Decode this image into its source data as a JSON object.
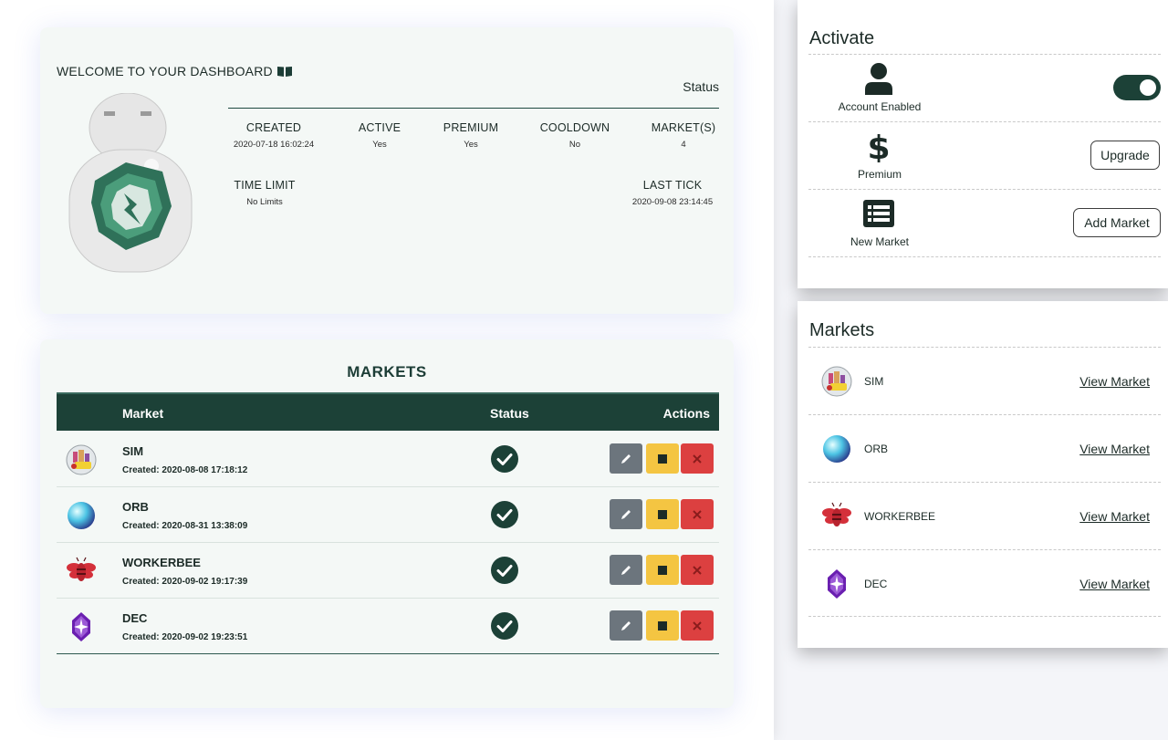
{
  "dashboard": {
    "welcome": "WELCOME TO YOUR DASHBOARD",
    "status_title": "Status",
    "stats": [
      {
        "label": "CREATED",
        "value": "2020-07-18 16:02:24"
      },
      {
        "label": "ACTIVE",
        "value": "Yes"
      },
      {
        "label": "PREMIUM",
        "value": "Yes"
      },
      {
        "label": "COOLDOWN",
        "value": "No"
      },
      {
        "label": "MARKET(S)",
        "value": "4"
      }
    ],
    "time_limit": {
      "label": "TIME LIMIT",
      "value": "No Limits"
    },
    "last_tick": {
      "label": "LAST TICK",
      "value": "2020-09-08 23:14:45"
    }
  },
  "markets_table": {
    "title": "MARKETS",
    "headers": {
      "market": "Market",
      "status": "Status",
      "actions": "Actions"
    },
    "rows": [
      {
        "name": "SIM",
        "created": "Created: 2020-08-08 17:18:12",
        "icon": "sim-city-icon"
      },
      {
        "name": "ORB",
        "created": "Created: 2020-08-31 13:38:09",
        "icon": "orb-icon"
      },
      {
        "name": "WORKERBEE",
        "created": "Created: 2020-09-02 19:17:39",
        "icon": "bee-icon"
      },
      {
        "name": "DEC",
        "created": "Created: 2020-09-02 19:23:51",
        "icon": "crystal-icon"
      }
    ]
  },
  "activate": {
    "title": "Activate",
    "items": [
      {
        "label": "Account Enabled",
        "icon": "user-icon",
        "control": "toggle",
        "enabled": true
      },
      {
        "label": "Premium",
        "icon": "dollar-icon",
        "control": "button",
        "button_label": "Upgrade"
      },
      {
        "label": "New Market",
        "icon": "list-icon",
        "control": "button",
        "button_label": "Add Market"
      }
    ]
  },
  "markets_panel": {
    "title": "Markets",
    "link_label": "View Market",
    "items": [
      {
        "name": "SIM"
      },
      {
        "name": "ORB"
      },
      {
        "name": "WORKERBEE"
      },
      {
        "name": "DEC"
      }
    ]
  },
  "colors": {
    "primary": "#1c4137",
    "edit": "#6c757d",
    "stop": "#f4c542",
    "delete": "#dc4040"
  }
}
